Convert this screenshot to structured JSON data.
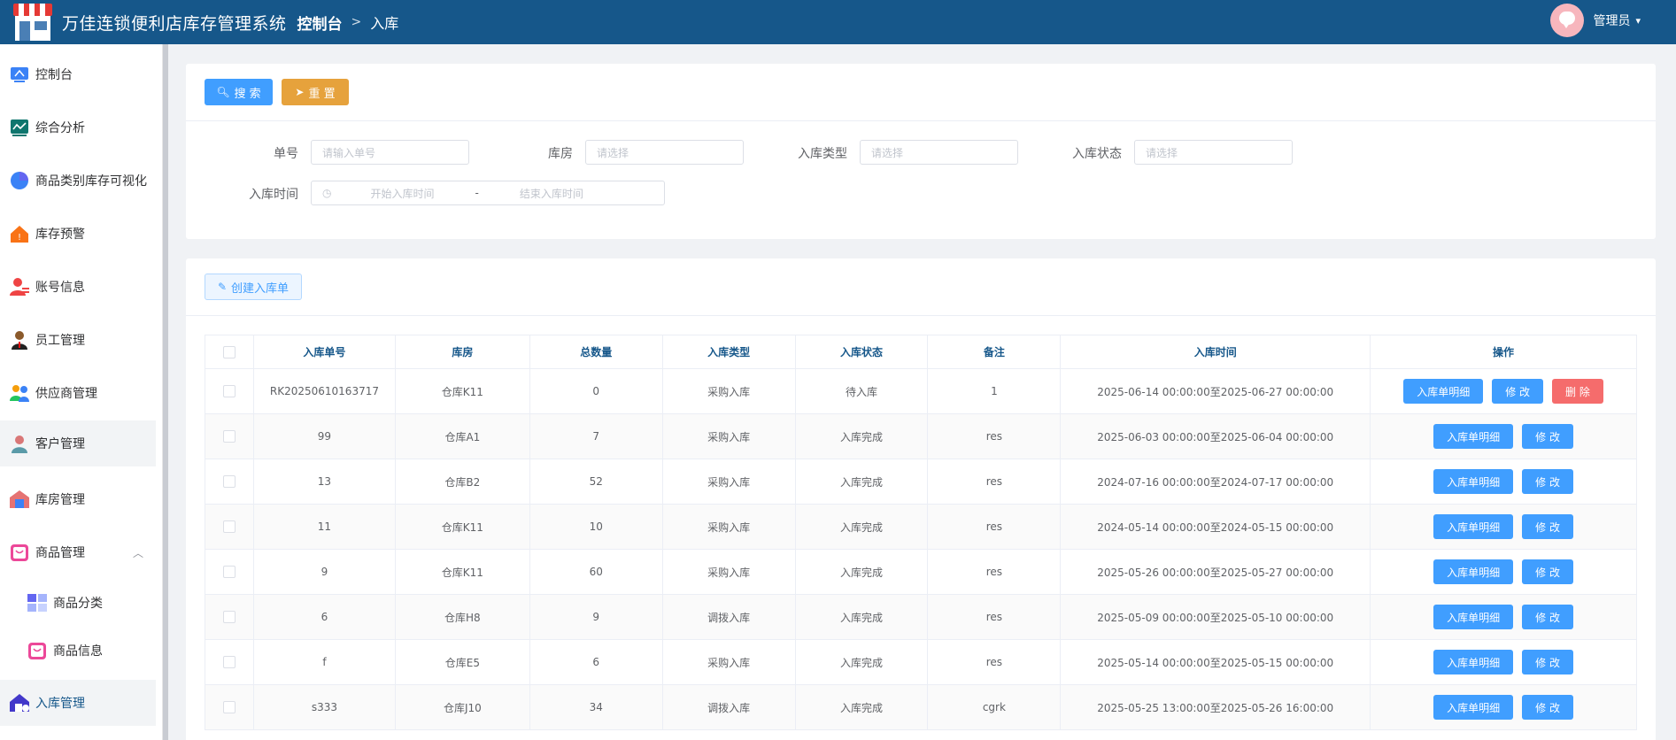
{
  "header": {
    "title": "万佳连锁便利店库存管理系统",
    "breadcrumb_home": "控制台",
    "breadcrumb_sep": ">",
    "breadcrumb_current": "入库",
    "user_name": "管理员",
    "bg_color": "#16578a"
  },
  "sidebar": {
    "items": [
      {
        "label": "控制台",
        "icon": "dashboard-icon"
      },
      {
        "label": "综合分析",
        "icon": "analysis-icon"
      },
      {
        "label": "商品类别库存可视化",
        "icon": "pie-chart-icon"
      },
      {
        "label": "库存预警",
        "icon": "warning-house-icon"
      },
      {
        "label": "账号信息",
        "icon": "account-icon"
      },
      {
        "label": "员工管理",
        "icon": "employee-icon"
      },
      {
        "label": "供应商管理",
        "icon": "supplier-icon"
      },
      {
        "label": "客户管理",
        "icon": "customer-icon"
      },
      {
        "label": "库房管理",
        "icon": "warehouse-icon"
      },
      {
        "label": "商品管理",
        "icon": "goods-icon"
      },
      {
        "label": "商品分类",
        "icon": "category-icon"
      },
      {
        "label": "商品信息",
        "icon": "goods-info-icon"
      },
      {
        "label": "入库管理",
        "icon": "inbound-icon"
      }
    ]
  },
  "search": {
    "search_label": "搜 索",
    "reset_label": "重 置",
    "fields": {
      "order_no": {
        "label": "单号",
        "placeholder": "请输入单号"
      },
      "warehouse": {
        "label": "库房",
        "placeholder": "请选择"
      },
      "type": {
        "label": "入库类型",
        "placeholder": "请选择"
      },
      "status": {
        "label": "入库状态",
        "placeholder": "请选择"
      },
      "time": {
        "label": "入库时间",
        "start_placeholder": "开始入库时间",
        "sep": "-",
        "end_placeholder": "结束入库时间"
      }
    }
  },
  "toolbar": {
    "create_label": "创建入库单"
  },
  "table": {
    "columns": [
      "入库单号",
      "库房",
      "总数量",
      "入库类型",
      "入库状态",
      "备注",
      "入库时间",
      "操作"
    ],
    "detail_label": "入库单明细",
    "edit_label": "修 改",
    "delete_label": "删 除",
    "rows": [
      {
        "no": "RK20250610163717",
        "warehouse": "仓库K11",
        "qty": "0",
        "type": "采购入库",
        "status": "待入库",
        "note": "1",
        "time": "2025-06-14 00:00:00至2025-06-27 00:00:00",
        "can_delete": true
      },
      {
        "no": "99",
        "warehouse": "仓库A1",
        "qty": "7",
        "type": "采购入库",
        "status": "入库完成",
        "note": "res",
        "time": "2025-06-03 00:00:00至2025-06-04 00:00:00",
        "can_delete": false
      },
      {
        "no": "13",
        "warehouse": "仓库B2",
        "qty": "52",
        "type": "采购入库",
        "status": "入库完成",
        "note": "res",
        "time": "2024-07-16 00:00:00至2024-07-17 00:00:00",
        "can_delete": false
      },
      {
        "no": "11",
        "warehouse": "仓库K11",
        "qty": "10",
        "type": "采购入库",
        "status": "入库完成",
        "note": "res",
        "time": "2024-05-14 00:00:00至2024-05-15 00:00:00",
        "can_delete": false
      },
      {
        "no": "9",
        "warehouse": "仓库K11",
        "qty": "60",
        "type": "采购入库",
        "status": "入库完成",
        "note": "res",
        "time": "2025-05-26 00:00:00至2025-05-27 00:00:00",
        "can_delete": false
      },
      {
        "no": "6",
        "warehouse": "仓库H8",
        "qty": "9",
        "type": "调拨入库",
        "status": "入库完成",
        "note": "res",
        "time": "2025-05-09 00:00:00至2025-05-10 00:00:00",
        "can_delete": false
      },
      {
        "no": "f",
        "warehouse": "仓库E5",
        "qty": "6",
        "type": "采购入库",
        "status": "入库完成",
        "note": "res",
        "time": "2025-05-14 00:00:00至2025-05-15 00:00:00",
        "can_delete": false
      },
      {
        "no": "s333",
        "warehouse": "仓库J10",
        "qty": "34",
        "type": "调拨入库",
        "status": "入库完成",
        "note": "cgrk",
        "time": "2025-05-25 13:00:00至2025-05-26 16:00:00",
        "can_delete": false
      }
    ]
  }
}
